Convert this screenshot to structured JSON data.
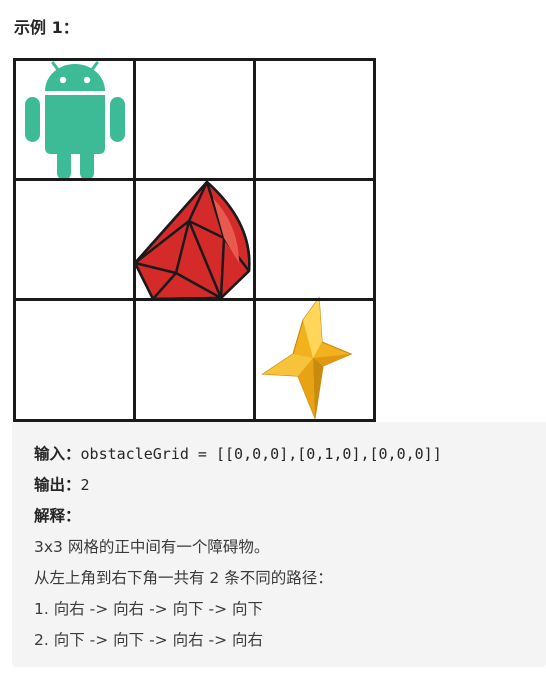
{
  "heading": "示例 1：",
  "grid": {
    "rows": 3,
    "cols": 3,
    "robot_cell": [
      0,
      0
    ],
    "obstacle_cell": [
      1,
      1
    ],
    "finish_cell": [
      2,
      2
    ],
    "icons": [
      "android-robot-icon",
      "red-rock-obstacle-icon",
      "gold-star-icon"
    ],
    "colors": {
      "robot": "#3dbb97",
      "obstacle": "#d42a2a",
      "star": "#f2b21e",
      "grid_line": "#1a1a1a"
    }
  },
  "example": {
    "input_label": "输入：",
    "input_value": "obstacleGrid = [[0,0,0],[0,1,0],[0,0,0]]",
    "output_label": "输出：",
    "output_value": "2",
    "explanation_label": "解释：",
    "explanation_lines": [
      "3x3 网格的正中间有一个障碍物。",
      "从左上角到右下角一共有 2 条不同的路径：",
      "1. 向右 -> 向右 -> 向下 -> 向下",
      "2. 向下 -> 向下 -> 向右 -> 向右"
    ]
  }
}
